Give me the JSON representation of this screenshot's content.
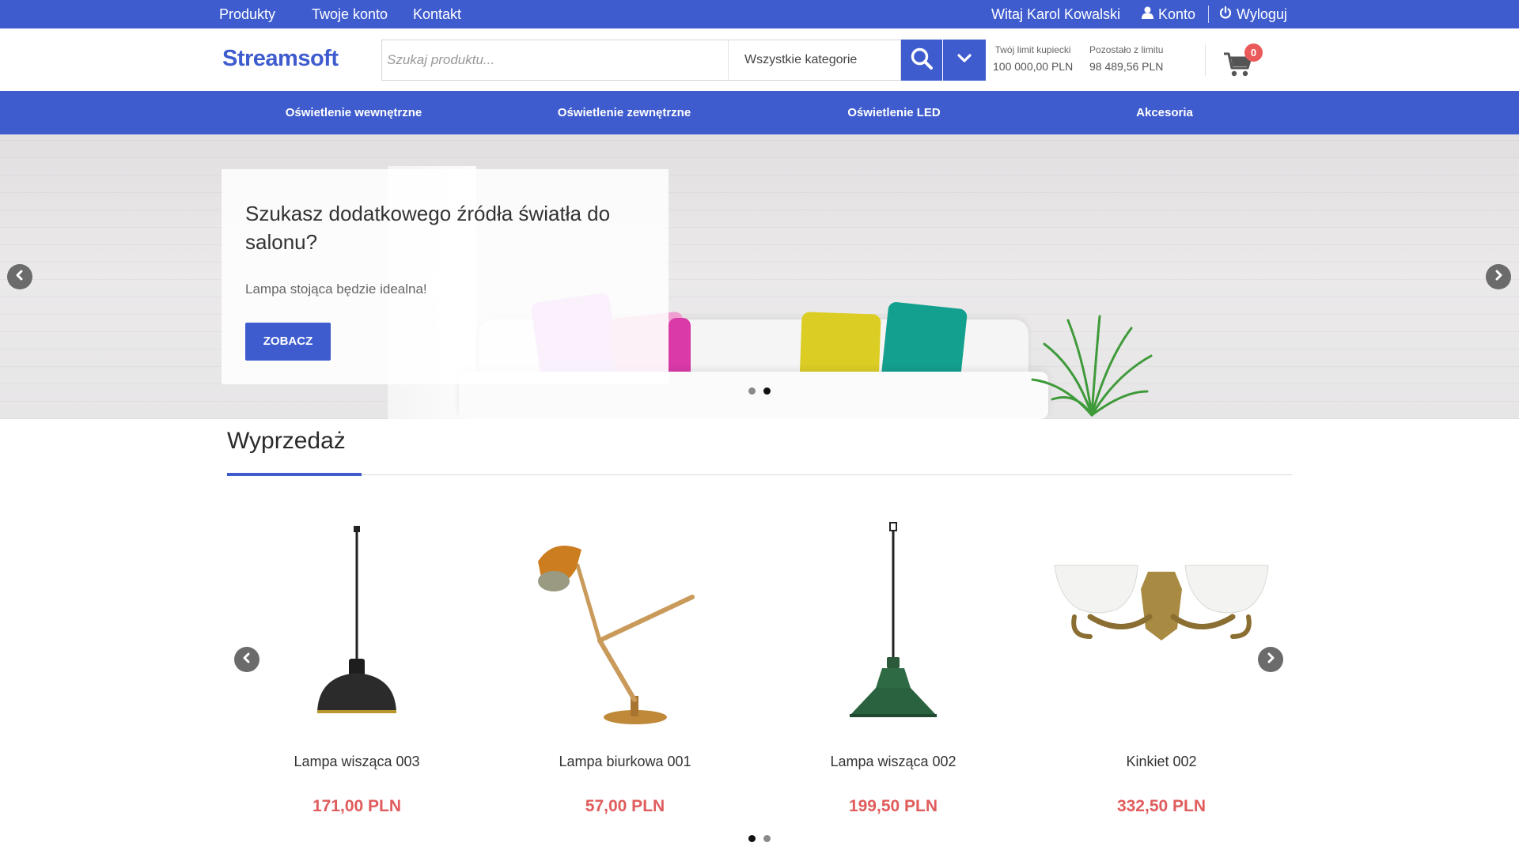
{
  "topbar": {
    "links": [
      "Produkty",
      "Twoje konto",
      "Kontakt"
    ],
    "greeting": "Witaj Karol Kowalski",
    "account_label": "Konto",
    "logout_label": "Wyloguj"
  },
  "header": {
    "logo": "Streamsoft",
    "search_placeholder": "Szukaj produktu...",
    "category_select": "Wszystkie kategorie",
    "limit_label": "Twój limit kupiecki",
    "limit_value": "100 000,00 PLN",
    "remaining_label": "Pozostało z limitu",
    "remaining_value": "98 489,56 PLN",
    "cart_count": "0"
  },
  "nav": {
    "items": [
      "Oświetlenie wewnętrzne",
      "Oświetlenie zewnętrzne",
      "Oświetlenie LED",
      "Akcesoria"
    ]
  },
  "hero": {
    "title": "Szukasz dodatkowego źródła światła do salonu?",
    "subtitle": "Lampa stojąca będzie idealna!",
    "button": "ZOBACZ",
    "active_slide": 2,
    "slide_count": 2
  },
  "sale": {
    "title": "Wyprzedaż",
    "products": [
      {
        "name": "Lampa wisząca 003",
        "price": "171,00 PLN"
      },
      {
        "name": "Lampa biurkowa 001",
        "price": "57,00 PLN"
      },
      {
        "name": "Lampa wisząca 002",
        "price": "199,50 PLN"
      },
      {
        "name": "Kinkiet 002",
        "price": "332,50 PLN"
      }
    ],
    "active_page": 1,
    "page_count": 2
  },
  "colors": {
    "brand": "#3f5ccf",
    "price": "#e05c5c",
    "badge": "#ea5a5a"
  },
  "icons": [
    "user-icon",
    "power-icon",
    "search-icon",
    "chevron-down-icon",
    "cart-icon",
    "chevron-left-icon",
    "chevron-right-icon"
  ]
}
